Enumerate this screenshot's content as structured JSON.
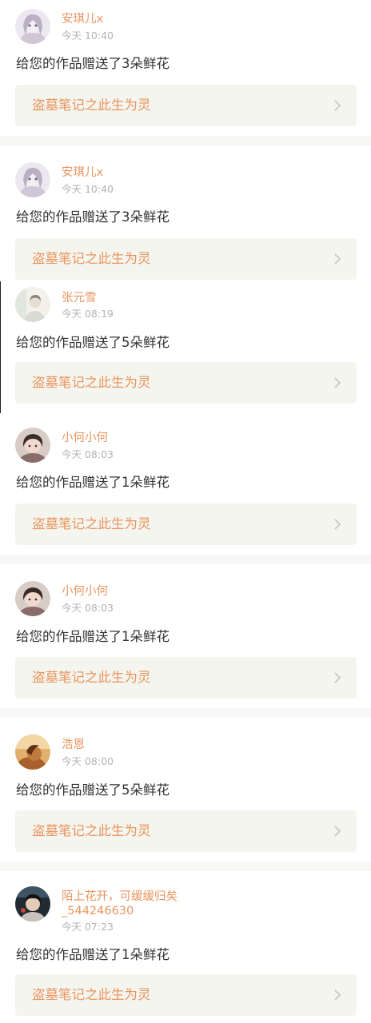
{
  "notifications": [
    {
      "username": "安琪儿x",
      "time": "今天 10:40",
      "message": "给您的作品赠送了3朵鲜花",
      "work_title": "盗墓笔记之此生为灵"
    },
    {
      "username": "安琪儿x",
      "time": "今天 10:40",
      "message": "给您的作品赠送了3朵鲜花",
      "work_title": "盗墓笔记之此生为灵"
    },
    {
      "username": "张元雪",
      "time": "今天 08:19",
      "message": "给您的作品赠送了5朵鲜花",
      "work_title": "盗墓笔记之此生为灵"
    },
    {
      "username": "小何小何",
      "time": "今天 08:03",
      "message": "给您的作品赠送了1朵鲜花",
      "work_title": "盗墓笔记之此生为灵"
    },
    {
      "username": "小何小何",
      "time": "今天 08:03",
      "message": "给您的作品赠送了1朵鲜花",
      "work_title": "盗墓笔记之此生为灵"
    },
    {
      "username": "浩恩",
      "time": "今天 08:00",
      "message": "给您的作品赠送了5朵鲜花",
      "work_title": "盗墓笔记之此生为灵"
    },
    {
      "username": "陌上花开，可缓缓归矣",
      "username_line2": "_544246630",
      "time": "今天 07:23",
      "message": "给您的作品赠送了1朵鲜花",
      "work_title": "盗墓笔记之此生为灵"
    }
  ],
  "colors": {
    "accent": "#e8955e",
    "muted": "#b3b3b3",
    "text": "#333333",
    "link_bg": "#f5f5ef",
    "divider": "#f7f7f5"
  },
  "icons": {
    "avatar": "user-avatar",
    "chevron": "chevron-right-icon"
  }
}
